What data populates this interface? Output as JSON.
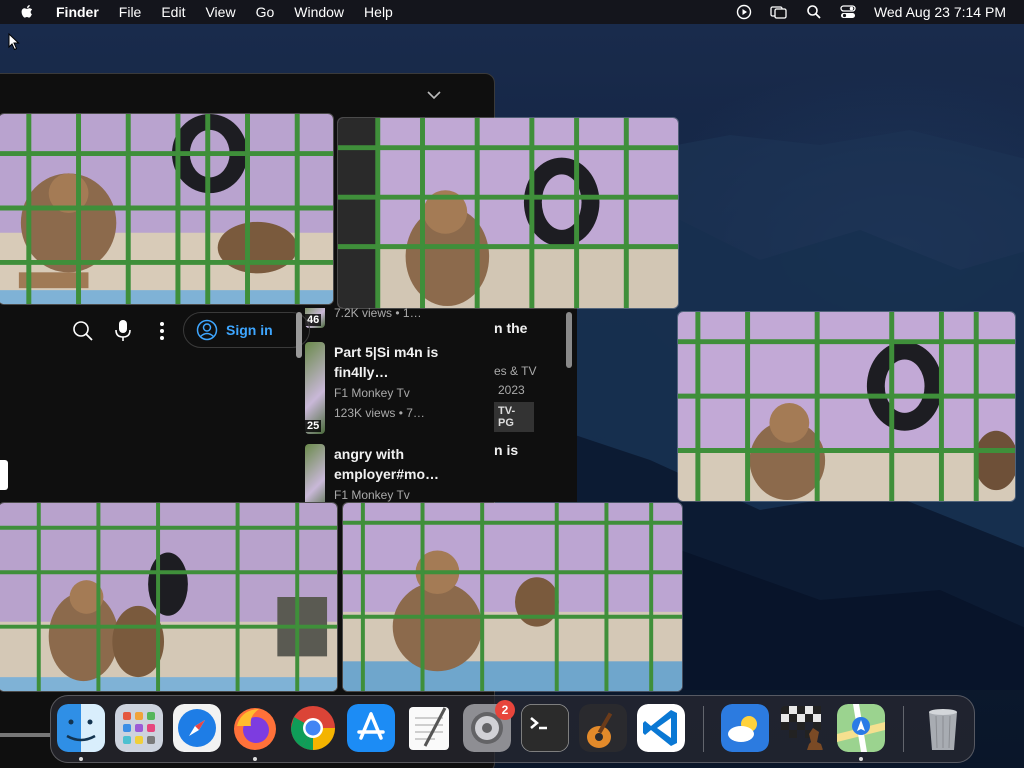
{
  "menubar": {
    "app_name": "Finder",
    "items": [
      "File",
      "Edit",
      "View",
      "Go",
      "Window",
      "Help"
    ],
    "clock": "Wed Aug 23  7:14 PM",
    "status_icons": [
      "screen-recording-icon",
      "screen-mirroring-icon",
      "spotlight-search-icon",
      "control-center-icon"
    ]
  },
  "browser": {
    "signin_label": "Sign in",
    "toolbar_icons": [
      "search-icon",
      "microphone-icon",
      "more-options-icon"
    ],
    "videos": [
      {
        "title": "",
        "channel": "",
        "stats": "7.2K views  •  1…",
        "duration": "46"
      },
      {
        "title": "Part 5|Si m4n is fin4lly…",
        "channel": "F1 Monkey Tv",
        "stats": "123K views  • 7…",
        "duration": "25"
      },
      {
        "title": "angry with employer#mo…",
        "channel": "F1 Monkey Tv",
        "stats": "",
        "duration": ""
      }
    ],
    "peek": {
      "title_1": "n the",
      "meta_1": "es & TV",
      "meta_2": "2023",
      "rating": "TV-PG",
      "title_2": "n is"
    }
  },
  "tiles": [
    {
      "name": "monkey-video-frame-1"
    },
    {
      "name": "monkey-video-frame-2"
    },
    {
      "name": "monkey-video-frame-3"
    },
    {
      "name": "monkey-video-frame-4"
    },
    {
      "name": "monkey-video-frame-5"
    }
  ],
  "dock": {
    "apps": [
      "Finder",
      "Launchpad",
      "Safari",
      "Firefox",
      "Chrome",
      "App Store",
      "TextEdit",
      "System Settings",
      "Terminal",
      "GarageBand",
      "Visual Studio Code",
      "Weather",
      "Chess",
      "Maps",
      "Trash"
    ],
    "settings_badge": "2"
  }
}
